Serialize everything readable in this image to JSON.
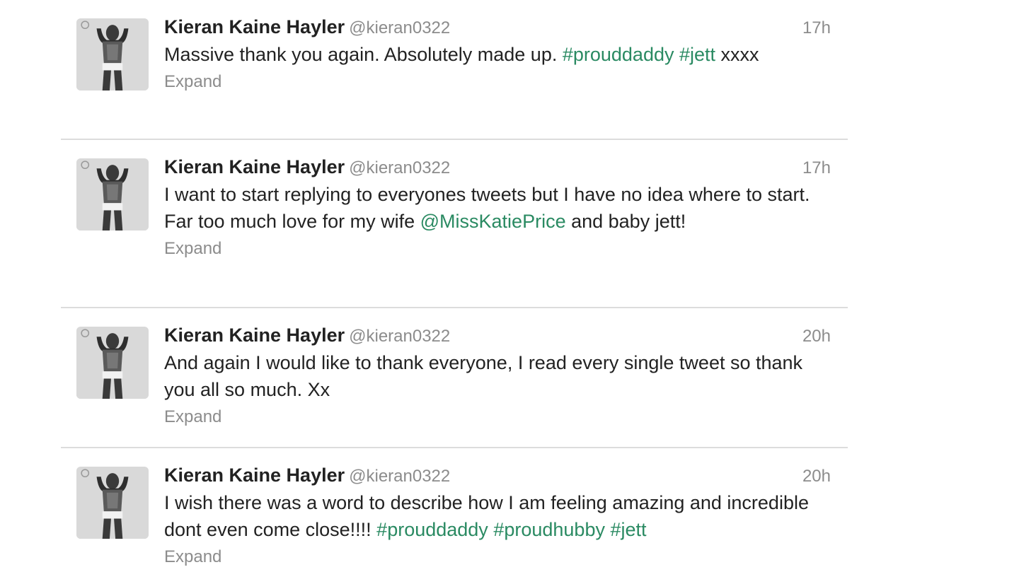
{
  "tweets": [
    {
      "name": "Kieran Kaine Hayler",
      "handle": "@kieran0322",
      "time": "17h",
      "segments": [
        {
          "type": "text",
          "value": "Massive thank you again. Absolutely made up. "
        },
        {
          "type": "hashtag",
          "value": "#prouddaddy"
        },
        {
          "type": "text",
          "value": " "
        },
        {
          "type": "hashtag",
          "value": "#jett"
        },
        {
          "type": "text",
          "value": " xxxx"
        }
      ],
      "expand": "Expand"
    },
    {
      "name": "Kieran Kaine Hayler",
      "handle": "@kieran0322",
      "time": "17h",
      "segments": [
        {
          "type": "text",
          "value": "I want to start replying to everyones tweets but I have no idea where to start. Far too much love for my wife "
        },
        {
          "type": "mention",
          "value": "@MissKatiePrice"
        },
        {
          "type": "text",
          "value": " and baby jett!"
        }
      ],
      "expand": "Expand"
    },
    {
      "name": "Kieran Kaine Hayler",
      "handle": "@kieran0322",
      "time": "20h",
      "segments": [
        {
          "type": "text",
          "value": "And again I would like to thank everyone, I read every single tweet so thank you all so much. Xx"
        }
      ],
      "expand": "Expand"
    },
    {
      "name": "Kieran Kaine Hayler",
      "handle": "@kieran0322",
      "time": "20h",
      "segments": [
        {
          "type": "text",
          "value": "I wish there was a word to describe how I am feeling amazing and incredible dont even come close!!!! "
        },
        {
          "type": "hashtag",
          "value": "#prouddaddy"
        },
        {
          "type": "text",
          "value": " "
        },
        {
          "type": "hashtag",
          "value": "#proudhubby"
        },
        {
          "type": "text",
          "value": " "
        },
        {
          "type": "hashtag",
          "value": "#jett"
        }
      ],
      "expand": "Expand"
    }
  ],
  "colors": {
    "link": "#2a8a62",
    "muted": "#8c8c8c",
    "divider": "#dcdcdc"
  },
  "icons": {
    "avatar": "user-avatar-photo"
  }
}
